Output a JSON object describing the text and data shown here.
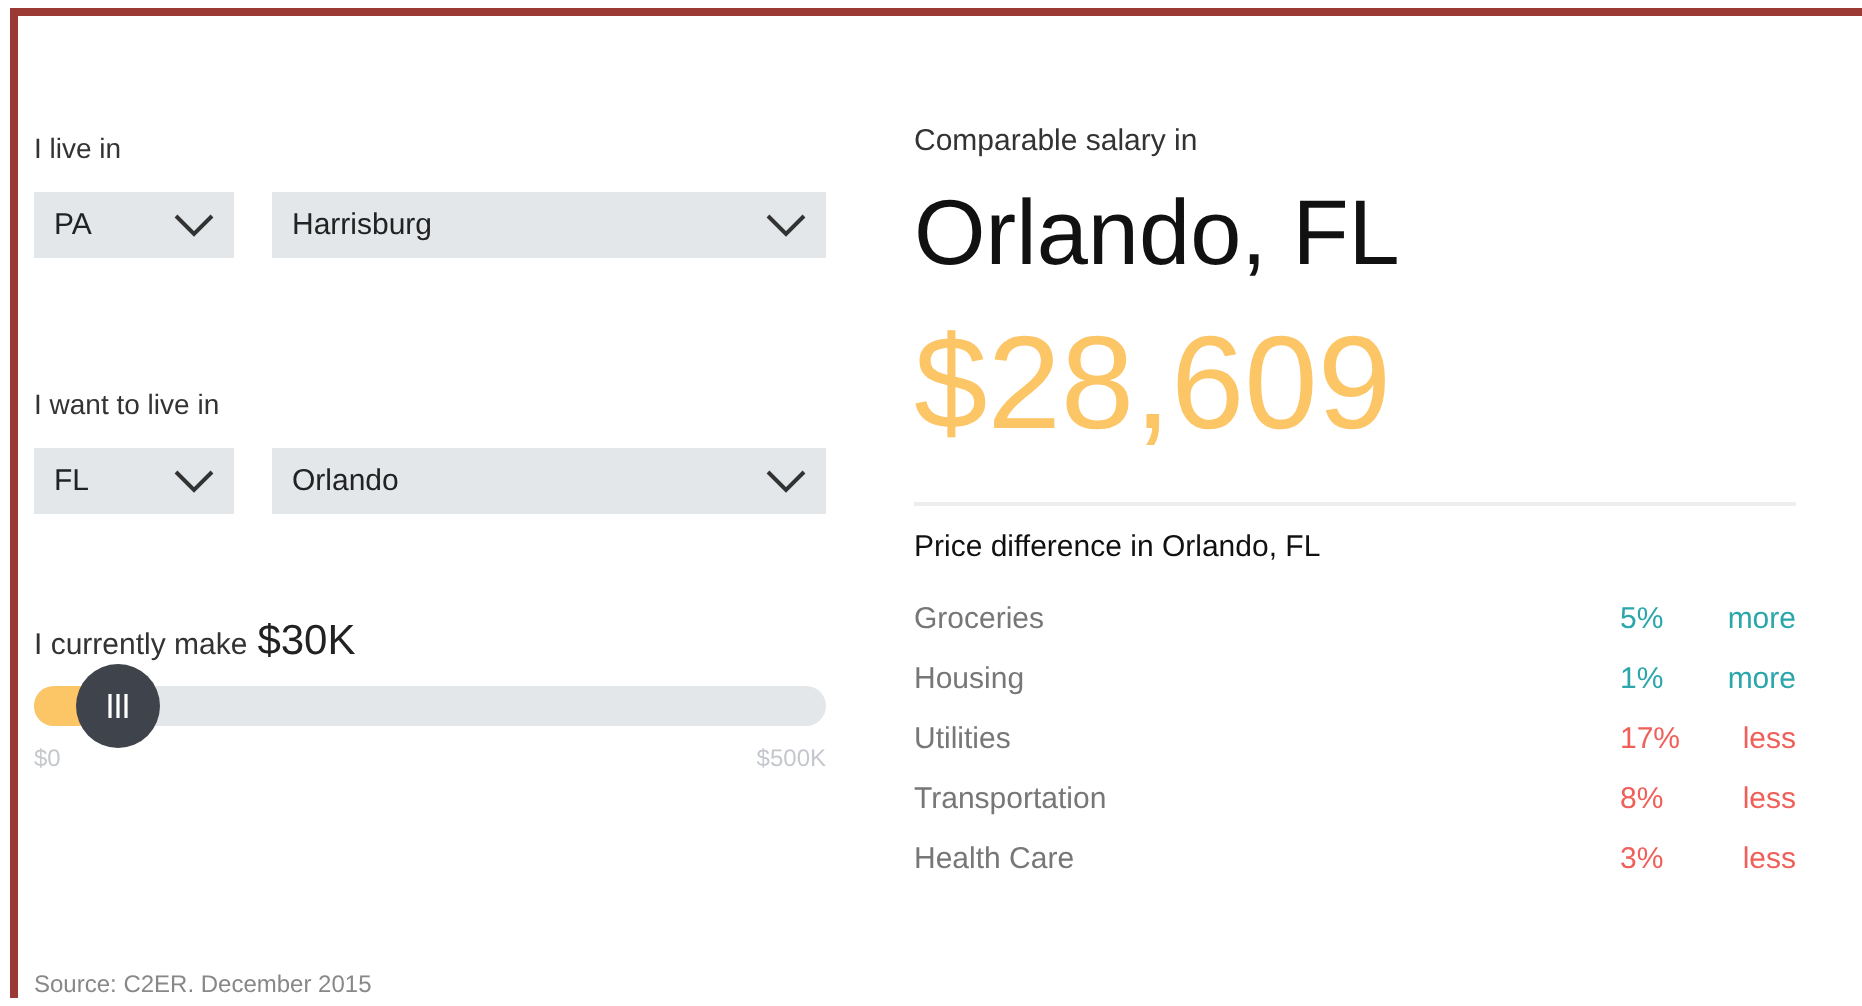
{
  "origin": {
    "label": "I live in",
    "state": "PA",
    "city": "Harrisburg"
  },
  "destination": {
    "label": "I want to live in",
    "state": "FL",
    "city": "Orlando"
  },
  "salary": {
    "label": "I currently make",
    "value": "$30K",
    "level": 0.06,
    "min_label": "$0",
    "max_label": "$500K"
  },
  "source": "Source: C2ER. December 2015",
  "result": {
    "label": "Comparable salary in",
    "city": "Orlando, FL",
    "amount": "$28,609"
  },
  "price_difference": {
    "title": "Price difference in Orlando, FL",
    "rows": [
      {
        "category": "Groceries",
        "percent": "5%",
        "direction": "more",
        "kind": "increase"
      },
      {
        "category": "Housing",
        "percent": "1%",
        "direction": "more",
        "kind": "increase"
      },
      {
        "category": "Utilities",
        "percent": "17%",
        "direction": "less",
        "kind": "decrease"
      },
      {
        "category": "Transportation",
        "percent": "8%",
        "direction": "less",
        "kind": "decrease"
      },
      {
        "category": "Health Care",
        "percent": "3%",
        "direction": "less",
        "kind": "decrease"
      }
    ]
  }
}
